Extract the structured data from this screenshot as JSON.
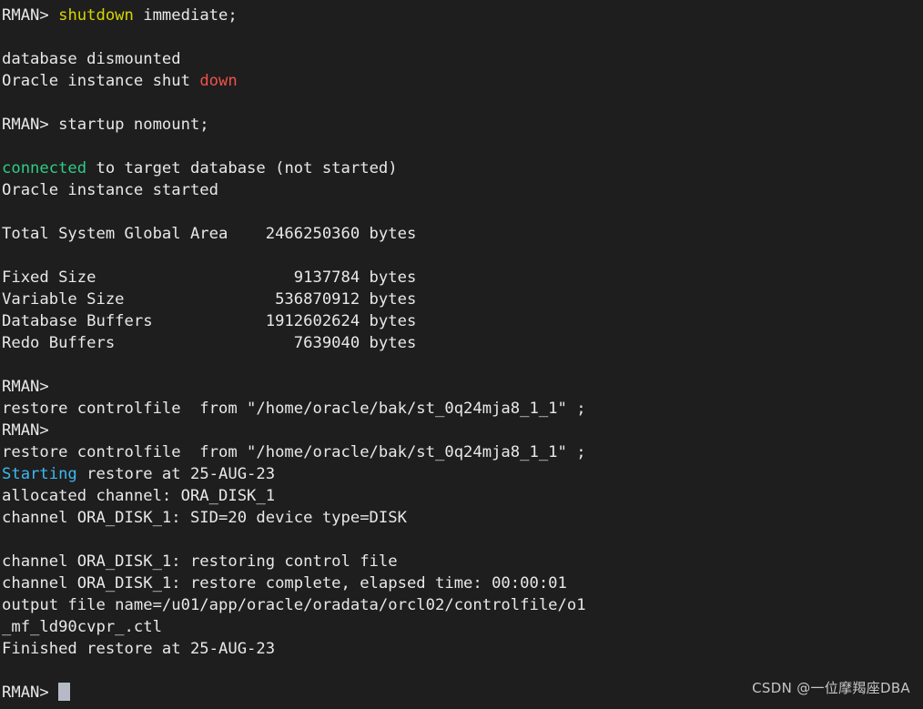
{
  "terminal": {
    "app": "RMAN console",
    "background_color": "#1e1e1e",
    "foreground_color": "#e8e8e8",
    "colors": {
      "yellow": "#d6d600",
      "red": "#f0504a",
      "green": "#2ecc84",
      "cyan": "#3cb9f2",
      "cursor": "#b6bac6"
    },
    "prompt": "RMAN>",
    "lines": [
      {
        "id": "l01",
        "segments": [
          {
            "text": "RMAN> ",
            "color": "default"
          },
          {
            "text": "shutdown",
            "color": "yellow"
          },
          {
            "text": " immediate;",
            "color": "default"
          }
        ]
      },
      {
        "id": "l02",
        "segments": []
      },
      {
        "id": "l03",
        "segments": [
          {
            "text": "database dismounted",
            "color": "default"
          }
        ]
      },
      {
        "id": "l04",
        "segments": [
          {
            "text": "Oracle instance shut ",
            "color": "default"
          },
          {
            "text": "down",
            "color": "red"
          }
        ]
      },
      {
        "id": "l05",
        "segments": []
      },
      {
        "id": "l06",
        "segments": [
          {
            "text": "RMAN> startup nomount;",
            "color": "default"
          }
        ]
      },
      {
        "id": "l07",
        "segments": []
      },
      {
        "id": "l08",
        "segments": [
          {
            "text": "connected",
            "color": "green"
          },
          {
            "text": " to target database (not started)",
            "color": "default"
          }
        ]
      },
      {
        "id": "l09",
        "segments": [
          {
            "text": "Oracle instance started",
            "color": "default"
          }
        ]
      },
      {
        "id": "l10",
        "segments": []
      },
      {
        "id": "l11",
        "segments": [
          {
            "text": "Total System Global Area    2466250360 bytes",
            "color": "default"
          }
        ]
      },
      {
        "id": "l12",
        "segments": []
      },
      {
        "id": "l13",
        "segments": [
          {
            "text": "Fixed Size                     9137784 bytes",
            "color": "default"
          }
        ]
      },
      {
        "id": "l14",
        "segments": [
          {
            "text": "Variable Size                536870912 bytes",
            "color": "default"
          }
        ]
      },
      {
        "id": "l15",
        "segments": [
          {
            "text": "Database Buffers            1912602624 bytes",
            "color": "default"
          }
        ]
      },
      {
        "id": "l16",
        "segments": [
          {
            "text": "Redo Buffers                   7639040 bytes",
            "color": "default"
          }
        ]
      },
      {
        "id": "l17",
        "segments": []
      },
      {
        "id": "l18",
        "segments": [
          {
            "text": "RMAN>",
            "color": "default"
          }
        ]
      },
      {
        "id": "l19",
        "segments": [
          {
            "text": "restore controlfile  from \"/home/oracle/bak/st_0q24mja8_1_1\" ;",
            "color": "default"
          }
        ]
      },
      {
        "id": "l20",
        "segments": [
          {
            "text": "RMAN>",
            "color": "default"
          }
        ]
      },
      {
        "id": "l21",
        "segments": [
          {
            "text": "restore controlfile  from \"/home/oracle/bak/st_0q24mja8_1_1\" ;",
            "color": "default"
          }
        ]
      },
      {
        "id": "l22",
        "segments": [
          {
            "text": "Starting",
            "color": "cyan"
          },
          {
            "text": " restore at 25-AUG-23",
            "color": "default"
          }
        ]
      },
      {
        "id": "l23",
        "segments": [
          {
            "text": "allocated channel: ORA_DISK_1",
            "color": "default"
          }
        ]
      },
      {
        "id": "l24",
        "segments": [
          {
            "text": "channel ORA_DISK_1: SID=20 device type=DISK",
            "color": "default"
          }
        ]
      },
      {
        "id": "l25",
        "segments": []
      },
      {
        "id": "l26",
        "segments": [
          {
            "text": "channel ORA_DISK_1: restoring control file",
            "color": "default"
          }
        ]
      },
      {
        "id": "l27",
        "segments": [
          {
            "text": "channel ORA_DISK_1: restore complete, elapsed time: 00:00:01",
            "color": "default"
          }
        ]
      },
      {
        "id": "l28",
        "segments": [
          {
            "text": "output file name=/u01/app/oracle/oradata/orcl02/controlfile/o1",
            "color": "default"
          }
        ]
      },
      {
        "id": "l29",
        "segments": [
          {
            "text": "_mf_ld90cvpr_.ctl",
            "color": "default"
          }
        ]
      },
      {
        "id": "l30",
        "segments": [
          {
            "text": "Finished restore at 25-AUG-23",
            "color": "default"
          }
        ]
      },
      {
        "id": "l31",
        "segments": []
      },
      {
        "id": "l32",
        "segments": [
          {
            "text": "RMAN> ",
            "color": "default"
          }
        ],
        "cursor": true
      }
    ]
  },
  "watermark": {
    "text": "CSDN @一位摩羯座DBA"
  }
}
